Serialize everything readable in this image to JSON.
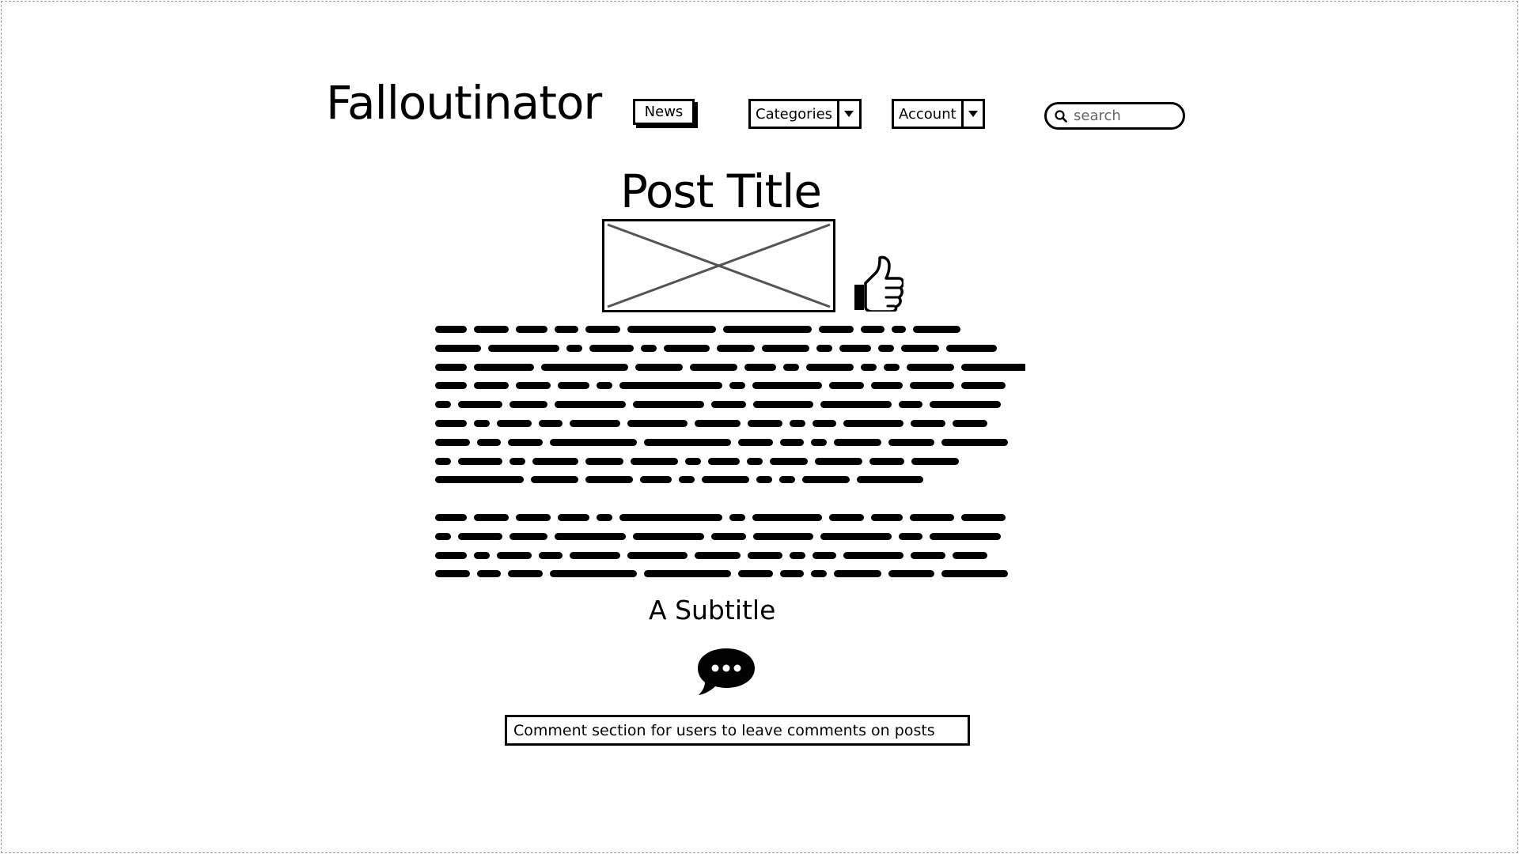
{
  "header": {
    "logo": "Falloutinator",
    "nav": {
      "news_label": "News",
      "categories_label": "Categories",
      "account_label": "Account"
    },
    "search": {
      "placeholder": "search"
    }
  },
  "post": {
    "title": "Post Title",
    "subtitle": "A Subtitle",
    "comment_box_text": "Comment section for users to leave comments on posts"
  },
  "icons": {
    "image_placeholder": "image-placeholder-icon",
    "like": "thumbs-up-icon",
    "comment": "speech-bubble-icon",
    "search": "search-icon",
    "dropdown": "chevron-down-icon"
  }
}
